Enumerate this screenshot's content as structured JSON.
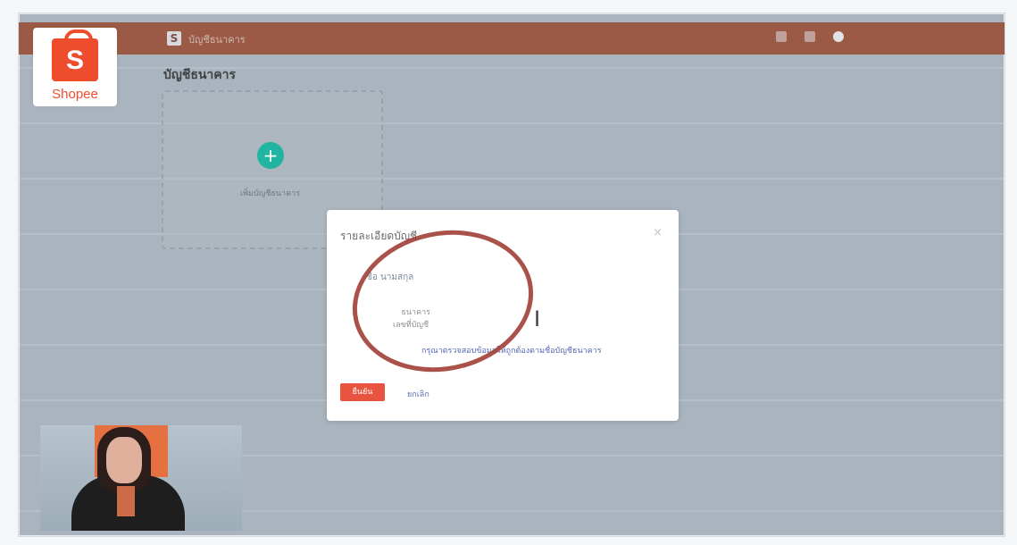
{
  "topbar": {
    "breadcrumb": "บัญชีธนาคาร",
    "shop_name": ""
  },
  "logo": {
    "mark": "S",
    "brand": "Shopee"
  },
  "main": {
    "title": "บัญชีธนาคาร",
    "add_button_symbol": "+",
    "add_label": "เพิ่มบัญชีธนาคาร"
  },
  "modal": {
    "title": "รายละเอียดบัญชี",
    "close": "×",
    "field_1": "ชื่อ นามสกุล",
    "field_2_line1": "ธนาคาร",
    "field_2_line2": "เลขที่บัญชี",
    "note": "กรุณาตรวจสอบข้อมูลให้ถูกต้องตามชื่อบัญชีธนาคาร",
    "primary_button": "ยืนยัน",
    "cancel_button": "ยกเลิก"
  },
  "colors": {
    "topbar": "#9a5a45",
    "brand": "#ee4d2d",
    "teal": "#21b4a0",
    "circle": "#a13f35"
  },
  "icons": {
    "topbar_icons": [
      "help-icon",
      "apps-grid-icon",
      "user-avatar-icon"
    ],
    "cursor": "text-cursor-icon"
  }
}
